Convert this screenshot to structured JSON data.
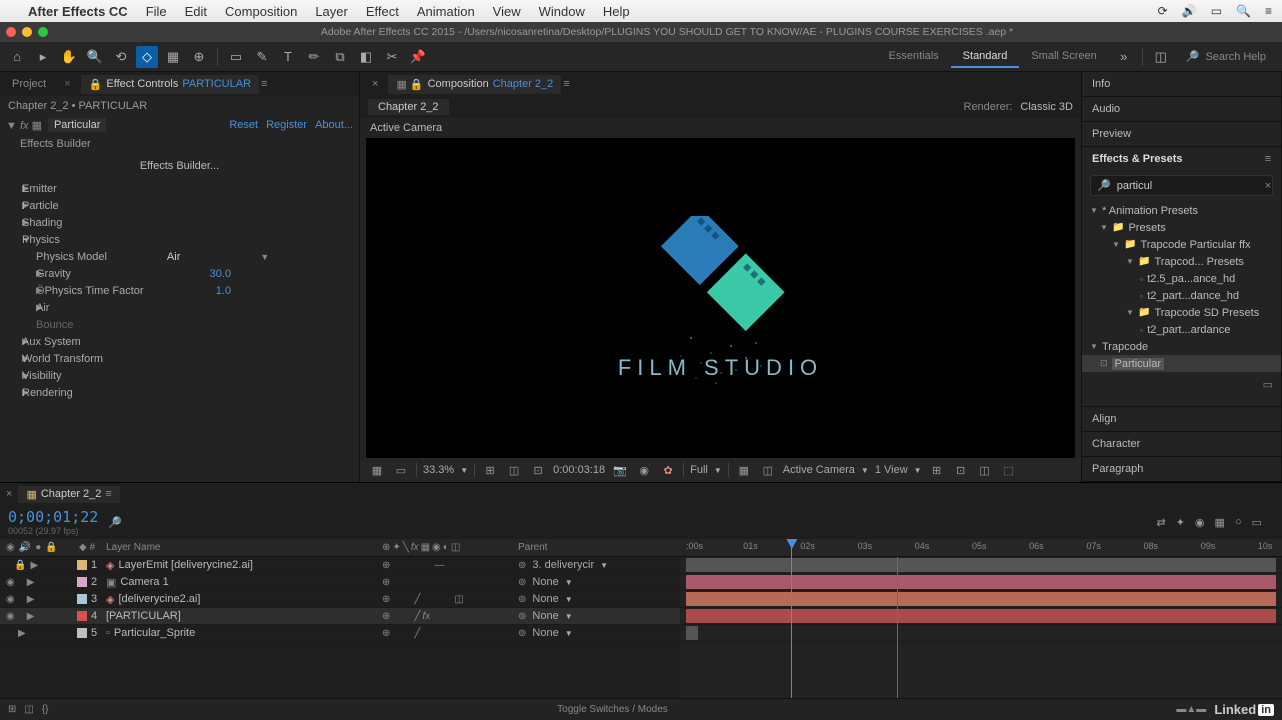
{
  "mac_menu": {
    "app": "After Effects CC",
    "items": [
      "File",
      "Edit",
      "Composition",
      "Layer",
      "Effect",
      "Animation",
      "View",
      "Window",
      "Help"
    ]
  },
  "window_title": "Adobe After Effects CC 2015 - /Users/nicosanretina/Desktop/PLUGINS YOU SHOULD GET  TO KNOW/AE - PLUGINS COURSE EXERCISES .aep *",
  "workspaces": {
    "items": [
      "Essentials",
      "Standard",
      "Small Screen"
    ],
    "active": 1
  },
  "search_placeholder": "Search Help",
  "left": {
    "project_tab": "Project",
    "fx_tab": "Effect Controls PARTICULAR",
    "path": "Chapter 2_2 • PARTICULAR",
    "fx_name": "Particular",
    "links": {
      "reset": "Reset",
      "register": "Register",
      "about": "About..."
    },
    "builder_label": "Effects Builder",
    "builder_btn": "Effects Builder...",
    "groups": {
      "emitter": "Emitter",
      "particle": "Particle",
      "shading": "Shading",
      "physics": "Physics",
      "aux": "Aux System",
      "world": "World Transform",
      "visibility": "Visibility",
      "rendering": "Rendering"
    },
    "physics": {
      "model_label": "Physics Model",
      "model_value": "Air",
      "gravity_label": "Gravity",
      "gravity_value": "30.0",
      "ptf_label": "Physics Time Factor",
      "ptf_value": "1.0",
      "air_label": "Air",
      "bounce_label": "Bounce"
    }
  },
  "center": {
    "comp_tab": "Composition Chapter 2_2",
    "subtab": "Chapter 2_2",
    "renderer_label": "Renderer:",
    "renderer_value": "Classic 3D",
    "active_camera": "Active Camera",
    "film_title": "FILM STUDIO",
    "controls": {
      "zoom": "33.3%",
      "timecode": "0:00:03:18",
      "resolution": "Full",
      "camera": "Active Camera",
      "view": "1 View"
    }
  },
  "right": {
    "info": "Info",
    "audio": "Audio",
    "preview": "Preview",
    "ep_title": "Effects & Presets",
    "search_value": "particul",
    "tree": {
      "anim_presets": "* Animation Presets",
      "presets": "Presets",
      "tp_ffx": "Trapcode Particular ffx",
      "tp_presets": "Trapcod... Presets",
      "t25": "t2.5_pa...ance_hd",
      "t2a": "t2_part...dance_hd",
      "tp_sd": "Trapcode SD Presets",
      "t2b": "t2_part...ardance",
      "trapcode": "Trapcode",
      "particular": "Particular"
    },
    "align": "Align",
    "character": "Character",
    "paragraph": "Paragraph"
  },
  "timeline": {
    "tab": "Chapter 2_2",
    "timecode": "0;00;01;22",
    "timecode_sub": "00052 (29.97 fps)",
    "col_num": "#",
    "col_name": "Layer Name",
    "col_parent": "Parent",
    "ruler": [
      ":00s",
      "01s",
      "02s",
      "03s",
      "04s",
      "05s",
      "06s",
      "07s",
      "08s",
      "09s",
      "10s"
    ],
    "layers": [
      {
        "num": "1",
        "color": "#d8b878",
        "icon": "◈",
        "name": "LayerEmit [deliverycine2.ai]",
        "parent": "3. deliverycir",
        "visible": false,
        "lock": true
      },
      {
        "num": "2",
        "color": "#d8a8c8",
        "icon": "▣",
        "name": "Camera 1",
        "parent": "None",
        "visible": true
      },
      {
        "num": "3",
        "color": "#a8c8d8",
        "icon": "◈",
        "name": "[deliverycine2.ai]",
        "parent": "None",
        "visible": true
      },
      {
        "num": "4",
        "color": "#d85050",
        "icon": "",
        "name": "[PARTICULAR]",
        "parent": "None",
        "visible": true,
        "selected": true
      },
      {
        "num": "5",
        "color": "#c0c0c0",
        "icon": "▫",
        "name": "Particular_Sprite",
        "parent": "None",
        "visible": false
      }
    ],
    "toggle": "Toggle Switches / Modes"
  },
  "branding": {
    "linked": "Linked",
    "in": "in"
  }
}
